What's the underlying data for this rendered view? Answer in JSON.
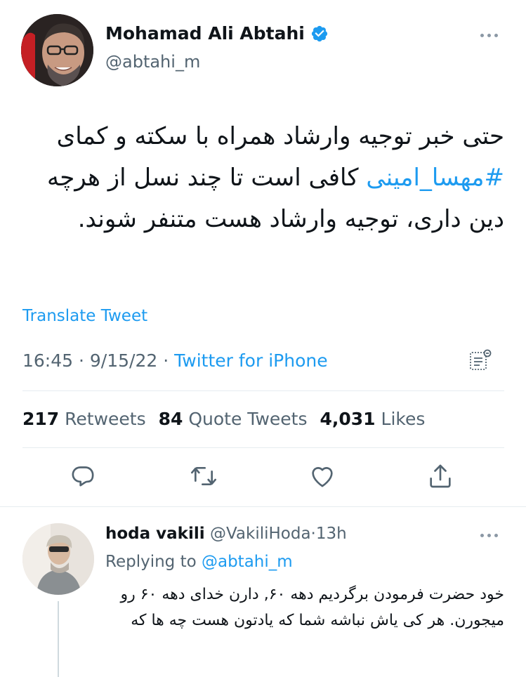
{
  "tweet": {
    "author_name": "Mohamad Ali Abtahi",
    "author_handle": "@abtahi_m",
    "text_before_hashtag": "حتی خبر توجیه وارشاد همراه با سکته و کمای ",
    "hashtag": "#مهسا_امینی",
    "text_after_hashtag": " کافی است تا چند نسل از هرچه دین داری، توجیه وارشاد هست متنفر شوند.",
    "translate_label": "Translate Tweet",
    "time": "16:45",
    "date": "9/15/22",
    "separator": "·",
    "source": "Twitter for iPhone",
    "stats": {
      "retweets_count": "217",
      "retweets_label": "Retweets",
      "quotes_count": "84",
      "quotes_label": "Quote Tweets",
      "likes_count": "4,031",
      "likes_label": "Likes"
    },
    "colors": {
      "accent": "#1d9bf0",
      "verified": "#1d9bf0",
      "secondary_text": "#536471"
    }
  },
  "reply": {
    "author_name": "hoda vakili",
    "author_handle": "@VakiliHoda",
    "separator": "·",
    "age": "13h",
    "replying_label": "Replying to",
    "replying_handle": "@abtahi_m",
    "text": "خود حضرت فرمودن برگردیم دهه ۶۰, دارن خدای دهه ۶۰ رو میجورن. هر کی یاش نباشه شما که یادتون هست چه ها که"
  },
  "icons": {
    "verified": "verified-badge-icon",
    "analytics": "tweet-analytics-icon",
    "reply": "reply-icon",
    "retweet": "retweet-icon",
    "like": "like-icon",
    "share": "share-icon",
    "more": "more-icon"
  }
}
